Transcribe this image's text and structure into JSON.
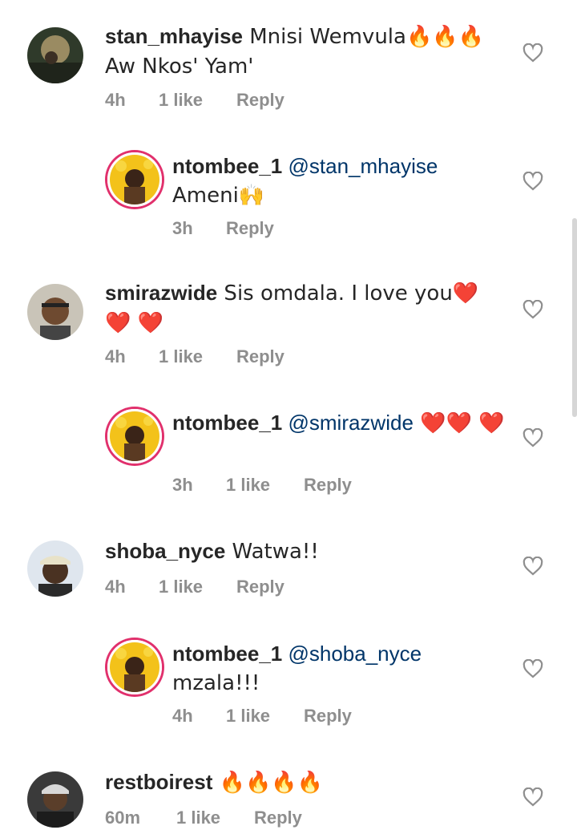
{
  "comments": [
    {
      "username": "stan_mhayise",
      "mention": "",
      "text": " Mnisi Wemvula🔥🔥🔥 Aw Nkos' Yam'",
      "time": "4h",
      "likes": "1 like",
      "reply": "Reply"
    },
    {
      "username": "ntombee_1",
      "mention": " @stan_mhayise",
      "text": " Ameni🙌",
      "time": "3h",
      "likes": "",
      "reply": "Reply"
    },
    {
      "username": "smirazwide",
      "mention": "",
      "text": " Sis omdala. I love you❤️❤️ ❤️",
      "time": "4h",
      "likes": "1 like",
      "reply": "Reply"
    },
    {
      "username": "ntombee_1",
      "mention": " @smirazwide",
      "text": " ❤️❤️ ❤️",
      "time": "3h",
      "likes": "1 like",
      "reply": "Reply"
    },
    {
      "username": "shoba_nyce",
      "mention": "",
      "text": " Watwa!!",
      "time": "4h",
      "likes": "1 like",
      "reply": "Reply"
    },
    {
      "username": "ntombee_1",
      "mention": " @shoba_nyce",
      "text": " mzala!!!",
      "time": "4h",
      "likes": "1 like",
      "reply": "Reply"
    },
    {
      "username": "restboirest",
      "mention": "",
      "text": " 🔥🔥🔥🔥",
      "time": "60m",
      "likes": "1 like",
      "reply": "Reply"
    }
  ],
  "icons": {
    "like": "heart-outline-icon"
  },
  "colors": {
    "meta": "#8e8e8e",
    "mention": "#003569",
    "story_ring": "#e1306c"
  }
}
